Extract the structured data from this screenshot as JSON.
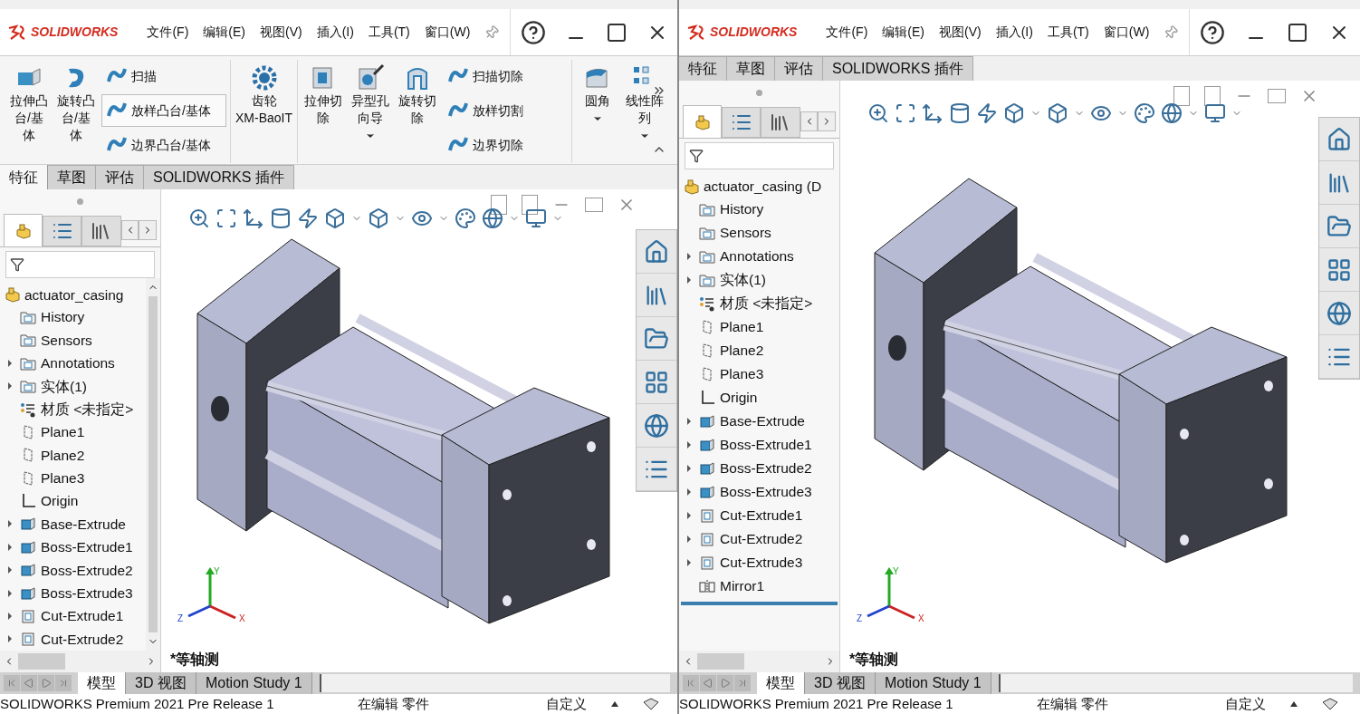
{
  "windows": [
    {
      "logo": "SOLIDWORKS",
      "menu": [
        "文件(F)",
        "编辑(E)",
        "视图(V)",
        "插入(I)",
        "工具(T)",
        "窗口(W)"
      ],
      "ribbon": {
        "groups": [
          [
            {
              "kind": "large",
              "lines": [
                "拉伸凸",
                "台/基",
                "体"
              ],
              "dropdown": false
            },
            {
              "kind": "large",
              "lines": [
                "旋转凸",
                "台/基",
                "体"
              ],
              "dropdown": false
            },
            {
              "kind": "smalls",
              "items": [
                {
                  "label": "扫描",
                  "highlighted": false
                },
                {
                  "label": "放样凸台/基体",
                  "highlighted": true
                },
                {
                  "label": "边界凸台/基体",
                  "highlighted": false
                }
              ]
            }
          ],
          [
            {
              "kind": "large",
              "lines": [
                "齿轮",
                "XM-BaoIT"
              ],
              "dropdown": false
            }
          ],
          [
            {
              "kind": "large",
              "lines": [
                "拉伸切",
                "除"
              ],
              "dropdown": false
            },
            {
              "kind": "large",
              "lines": [
                "异型孔",
                "向导"
              ],
              "dropdown": true
            },
            {
              "kind": "large",
              "lines": [
                "旋转切",
                "除"
              ],
              "dropdown": false
            },
            {
              "kind": "smalls",
              "items": [
                {
                  "label": "扫描切除",
                  "highlighted": false
                },
                {
                  "label": "放样切割",
                  "highlighted": false
                },
                {
                  "label": "边界切除",
                  "highlighted": false
                }
              ]
            }
          ],
          [
            {
              "kind": "large",
              "lines": [
                "圆角"
              ],
              "dropdown": true
            },
            {
              "kind": "large",
              "lines": [
                "线性阵",
                "列"
              ],
              "dropdown": true
            }
          ]
        ]
      },
      "tabs": [
        {
          "label": "特征",
          "selected": true
        },
        {
          "label": "草图",
          "selected": false
        },
        {
          "label": "评估",
          "selected": false
        },
        {
          "label": "SOLIDWORKS 插件",
          "selected": false
        }
      ],
      "tree": {
        "root": "actuator_casing",
        "items": [
          {
            "label": "History",
            "kind": "history",
            "expandable": false
          },
          {
            "label": "Sensors",
            "kind": "sensors",
            "expandable": false
          },
          {
            "label": "Annotations",
            "kind": "annotations",
            "expandable": true
          },
          {
            "label": "实体(1)",
            "kind": "bodies",
            "expandable": true
          },
          {
            "label": "材质 <未指定>",
            "kind": "material",
            "expandable": false
          },
          {
            "label": "Plane1",
            "kind": "plane",
            "expandable": false
          },
          {
            "label": "Plane2",
            "kind": "plane",
            "expandable": false
          },
          {
            "label": "Plane3",
            "kind": "plane",
            "expandable": false
          },
          {
            "label": "Origin",
            "kind": "origin",
            "expandable": false
          },
          {
            "label": "Base-Extrude",
            "kind": "extrude",
            "expandable": true
          },
          {
            "label": "Boss-Extrude1",
            "kind": "extrude",
            "expandable": true
          },
          {
            "label": "Boss-Extrude2",
            "kind": "extrude",
            "expandable": true
          },
          {
            "label": "Boss-Extrude3",
            "kind": "extrude",
            "expandable": true
          },
          {
            "label": "Cut-Extrude1",
            "kind": "cut",
            "expandable": true
          },
          {
            "label": "Cut-Extrude2",
            "kind": "cut",
            "expandable": true
          }
        ]
      },
      "view_label": "*等轴测",
      "triad": {
        "x": "X",
        "y": "Y",
        "z": "Z"
      },
      "bottom_tabs": [
        {
          "label": "模型",
          "selected": true
        },
        {
          "label": "3D 视图",
          "selected": false
        },
        {
          "label": "Motion Study 1",
          "selected": false
        }
      ],
      "status": [
        "SOLIDWORKS Premium 2021 Pre Release 1",
        "在编辑 零件",
        "自定义"
      ]
    },
    {
      "logo": "SOLIDWORKS",
      "menu": [
        "文件(F)",
        "编辑(E)",
        "视图(V)",
        "插入(I)",
        "工具(T)",
        "窗口(W)"
      ],
      "tabs": [
        {
          "label": "特征",
          "selected": false
        },
        {
          "label": "草图",
          "selected": false
        },
        {
          "label": "评估",
          "selected": false
        },
        {
          "label": "SOLIDWORKS 插件",
          "selected": false
        }
      ],
      "tree": {
        "root": "actuator_casing (D",
        "rollback_bar": true,
        "items": [
          {
            "label": "History",
            "kind": "history",
            "expandable": false
          },
          {
            "label": "Sensors",
            "kind": "sensors",
            "expandable": false
          },
          {
            "label": "Annotations",
            "kind": "annotations",
            "expandable": true
          },
          {
            "label": "实体(1)",
            "kind": "bodies",
            "expandable": true
          },
          {
            "label": "材质 <未指定>",
            "kind": "material",
            "expandable": false
          },
          {
            "label": "Plane1",
            "kind": "plane",
            "expandable": false
          },
          {
            "label": "Plane2",
            "kind": "plane",
            "expandable": false
          },
          {
            "label": "Plane3",
            "kind": "plane",
            "expandable": false
          },
          {
            "label": "Origin",
            "kind": "origin",
            "expandable": false
          },
          {
            "label": "Base-Extrude",
            "kind": "extrude",
            "expandable": true
          },
          {
            "label": "Boss-Extrude1",
            "kind": "extrude",
            "expandable": true
          },
          {
            "label": "Boss-Extrude2",
            "kind": "extrude",
            "expandable": true
          },
          {
            "label": "Boss-Extrude3",
            "kind": "extrude",
            "expandable": true
          },
          {
            "label": "Cut-Extrude1",
            "kind": "cut",
            "expandable": true
          },
          {
            "label": "Cut-Extrude2",
            "kind": "cut",
            "expandable": true
          },
          {
            "label": "Cut-Extrude3",
            "kind": "cut",
            "expandable": true
          },
          {
            "label": "Mirror1",
            "kind": "mirror",
            "expandable": false
          }
        ]
      },
      "view_label": "*等轴测",
      "triad": {
        "x": "X",
        "y": "Y",
        "z": "Z"
      },
      "bottom_tabs": [
        {
          "label": "模型",
          "selected": true
        },
        {
          "label": "3D 视图",
          "selected": false
        },
        {
          "label": "Motion Study 1",
          "selected": false
        }
      ],
      "status": [
        "SOLIDWORKS Premium 2021 Pre Release 1",
        "在编辑 零件",
        "自定义"
      ]
    }
  ]
}
